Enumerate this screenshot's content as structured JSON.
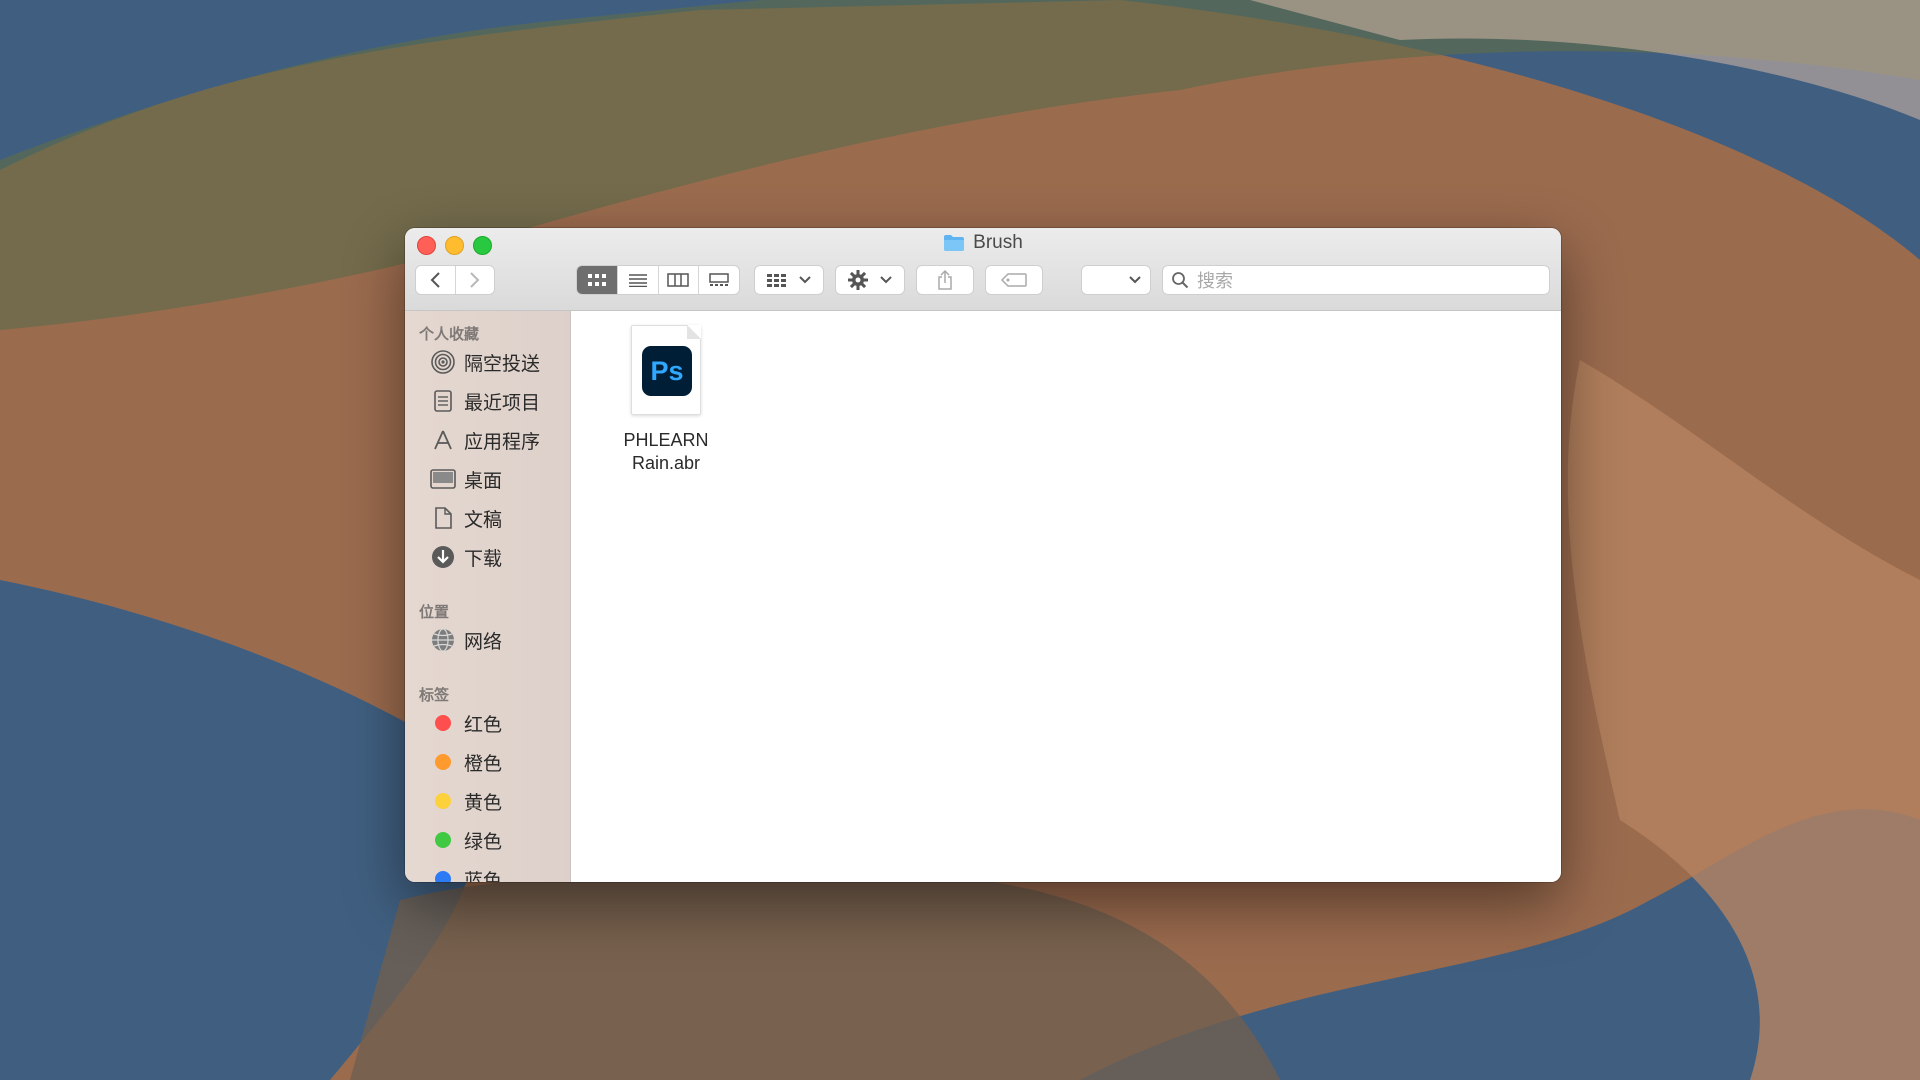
{
  "window": {
    "title": "Brush"
  },
  "toolbar": {
    "search_placeholder": "搜索"
  },
  "sidebar": {
    "favorites_header": "个人收藏",
    "favorites": [
      {
        "label": "隔空投送",
        "icon": "airdrop-icon"
      },
      {
        "label": "最近项目",
        "icon": "recents-icon"
      },
      {
        "label": "应用程序",
        "icon": "applications-icon"
      },
      {
        "label": "桌面",
        "icon": "desktop-icon"
      },
      {
        "label": "文稿",
        "icon": "documents-icon"
      },
      {
        "label": "下载",
        "icon": "downloads-icon"
      }
    ],
    "locations_header": "位置",
    "locations": [
      {
        "label": "网络",
        "icon": "network-icon"
      }
    ],
    "tags_header": "标签",
    "tags": [
      {
        "label": "红色",
        "color": "#fe4e4e"
      },
      {
        "label": "橙色",
        "color": "#fe9a2e"
      },
      {
        "label": "黄色",
        "color": "#fdd13b"
      },
      {
        "label": "绿色",
        "color": "#42c943"
      },
      {
        "label": "蓝色",
        "color": "#2c7bf5"
      }
    ]
  },
  "files": [
    {
      "name_line1": "PHLEARN",
      "name_line2": "Rain.abr",
      "icon_label": "Ps",
      "icon": "photoshop-file-icon"
    }
  ]
}
